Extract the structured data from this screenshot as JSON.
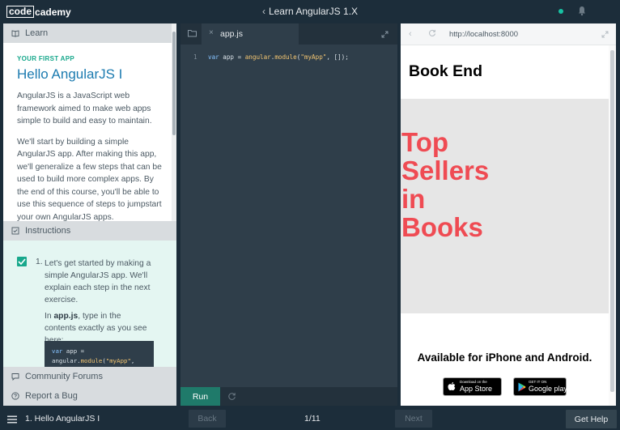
{
  "header": {
    "logo_box": "code",
    "logo_rest": "cademy",
    "course_title": "Learn AngularJS 1.X"
  },
  "learn": {
    "tab_label": "Learn",
    "eyebrow": "YOUR FIRST APP",
    "title": "Hello AngularJS I",
    "paragraphs": [
      "AngularJS is a JavaScript web framework aimed to make web apps simple to build and easy to maintain.",
      "We'll start by building a simple AngularJS app. After making this app, we'll generalize a few steps that can be used to build more complex apps. By the end of this course, you'll be able to use this sequence of steps to jumpstart your own AngularJS apps."
    ]
  },
  "instructions": {
    "tab_label": "Instructions",
    "step_number": "1.",
    "step_text": "Let's get started by making a simple AngularJS app. We'll explain each step in the next exercise.",
    "step_pre": "In ",
    "step_file": "app.js",
    "step_post": ", type in the contents exactly as you see here:",
    "code_kw": "var",
    "code_var": " app =",
    "code_obj": "angular.",
    "code_fn": "module",
    "code_paren": "(",
    "code_str": "\"myApp\"",
    "code_tail": ","
  },
  "left_footer": {
    "forum_label": "Community Forums",
    "report_label": "Report a Bug"
  },
  "editor": {
    "tab_label": "app.js",
    "line_number": "1",
    "code_kw": "var",
    "code_mid": " app = ",
    "code_obj": "angular",
    "code_dot": ".",
    "code_fn": "module",
    "code_open": "(",
    "code_str": "\"myApp\"",
    "code_rest": ", []);",
    "run_label": "Run"
  },
  "browser": {
    "url": "http://localhost:8000",
    "site_title": "Book End",
    "hero_lines": [
      "Top",
      "Sellers",
      "in",
      "Books"
    ],
    "availability": "Available for iPhone and Android.",
    "apple_small": "Download on the",
    "apple_big": "App Store",
    "google_small": "GET IT ON",
    "google_big": "Google play"
  },
  "footer": {
    "lesson_label": "1. Hello AngularJS I",
    "back_label": "Back",
    "page_count": "1/11",
    "next_label": "Next",
    "help_label": "Get Help"
  },
  "colors": {
    "accent": "#18a88c",
    "brand_dark": "#1c2d3a",
    "hero_red": "#ef4b53"
  },
  "icons": {
    "learn": "book-icon",
    "instructions": "checkbox-icon",
    "forum": "chat-icon",
    "report": "question-icon",
    "files": "folder-icon",
    "expand": "expand-icon",
    "reset": "reset-icon",
    "menu": "menu-icon",
    "notifications": "bell-icon"
  }
}
